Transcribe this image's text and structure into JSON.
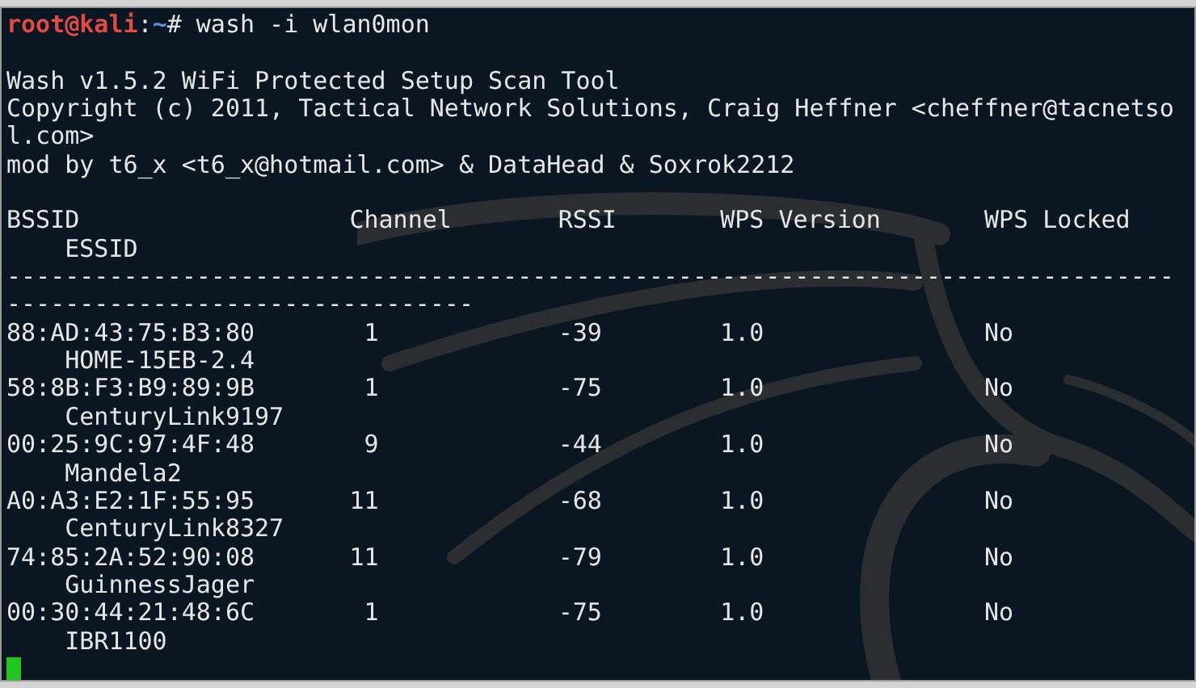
{
  "prompt": {
    "user_host": "root@kali",
    "separator": ":",
    "path": "~",
    "symbol": "#",
    "command": "wash -i wlan0mon"
  },
  "banner": [
    "Wash v1.5.2 WiFi Protected Setup Scan Tool",
    "Copyright (c) 2011, Tactical Network Solutions, Craig Heffner <cheffner@tacnetso",
    "l.com>",
    "mod by t6_x <t6_x@hotmail.com> & DataHead & Soxrok2212"
  ],
  "table": {
    "columns": [
      "BSSID",
      "Channel",
      "RSSI",
      "WPS Version",
      "WPS Locked",
      "ESSID"
    ],
    "separator": [
      "--------------------------------------------------------------------------------",
      "--------------------------------"
    ],
    "rows": [
      {
        "bssid": "88:AD:43:75:B3:80",
        "channel": "1",
        "rssi": "-39",
        "wps_version": "1.0",
        "wps_locked": "No",
        "essid": "HOME-15EB-2.4"
      },
      {
        "bssid": "58:8B:F3:B9:89:9B",
        "channel": "1",
        "rssi": "-75",
        "wps_version": "1.0",
        "wps_locked": "No",
        "essid": "CenturyLink9197"
      },
      {
        "bssid": "00:25:9C:97:4F:48",
        "channel": "9",
        "rssi": "-44",
        "wps_version": "1.0",
        "wps_locked": "No",
        "essid": "Mandela2"
      },
      {
        "bssid": "A0:A3:E2:1F:55:95",
        "channel": "11",
        "rssi": "-68",
        "wps_version": "1.0",
        "wps_locked": "No",
        "essid": "CenturyLink8327"
      },
      {
        "bssid": "74:85:2A:52:90:08",
        "channel": "11",
        "rssi": "-79",
        "wps_version": "1.0",
        "wps_locked": "No",
        "essid": "GuinnessJager"
      },
      {
        "bssid": "00:30:44:21:48:6C",
        "channel": "1",
        "rssi": "-75",
        "wps_version": "1.0",
        "wps_locked": "No",
        "essid": "IBR1100"
      }
    ]
  },
  "cursor": {
    "visible": true
  }
}
